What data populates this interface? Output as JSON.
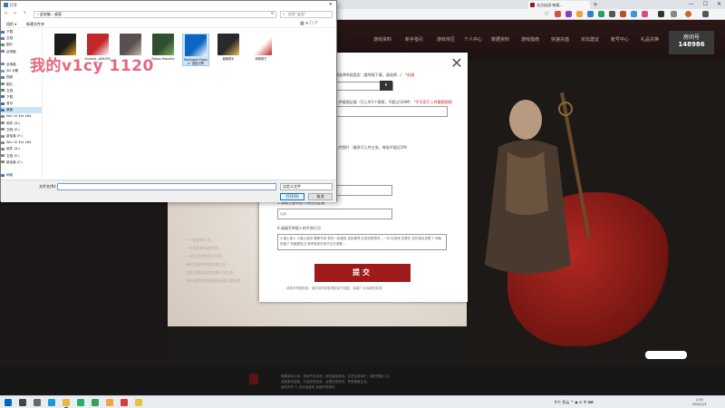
{
  "browser": {
    "tab_title": "太古仙语-修真…",
    "url_text": "",
    "new_tab": "+",
    "window_buttons": [
      "—",
      "☐",
      "✕"
    ],
    "star": "☆"
  },
  "site": {
    "nav_items": [
      "游戏资料",
      "新手指引",
      "游戏专区",
      "个人中心",
      "数据资料",
      "游戏指南",
      "快速充值",
      "论坛建议",
      "账号中心",
      "礼品兑换"
    ],
    "logo_text": "天下",
    "room_label": "房间号",
    "room_number": "148986",
    "left_lines": [
      "• 一些游戏行为…",
      "• 外挂作弊违规内容…",
      "• 扰乱游戏秩序行为等",
      "具体处理结果请查看公告",
      "对此问题及其他违规行为反馈",
      "举报请提供相关截图证据以便处理"
    ],
    "footer_lines": [
      "健康游戏公告：抵制不良游戏，拒绝盗版游戏。注意自我保护，谨防受骗上当。",
      "适度游戏益脑，沉迷游戏伤身。合理安排时间，享受健康生活。",
      "版权所有 © 游戏运营商 保留所有权利"
    ]
  },
  "form": {
    "close_glyph": "✕",
    "q1_label": "1.请选择举报类型（要举报下载，请选择…）",
    "q1_required": "*必填",
    "q1_select_arrow": "▾",
    "q2_label": "2.上传截图证据（可上传1个视频，不超过100M）",
    "q2_hint": "*不可用于上传截图视频",
    "q3_label": "3.上传图片（最多可上传五张，每张不超过5M）",
    "q4_label": "4.请填写被举报人的角色名",
    "q5_label": "5.请填写被举报人所在的区服",
    "q5_value": "仙缘",
    "q6_label": "6.请填写举报人的不良行为",
    "q6_value": "小道士偷人 小道士偷窃 屡教不改 冒充一起被捉 发帖辱骂 在游戏里冒充…一次 在游戏 还是在 这些事实说看了 你就知道了 有截图发过 被举报多的说不过去请看…",
    "submit": "提交",
    "footnote": "请填写举报信息，我们将尽快处理并给予回复，感谢广大玩家的支持！"
  },
  "dialog": {
    "title": "打开",
    "close_glyph": "✕",
    "nav_back": "←",
    "nav_forward": "→",
    "nav_up": "↑",
    "address_path": "› 此电脑 › 桌面",
    "refresh": "↻",
    "search_placeholder": "搜索\"桌面\"",
    "search_icon": "⌕",
    "cmd_organize": "组织 ▾",
    "cmd_newfolder": "新建文件夹",
    "view_icons": "▦ ▾  ☐  ?",
    "sidebar": [
      {
        "label": "下载",
        "color": "#3a78c3"
      },
      {
        "label": "文档",
        "color": "#6a7a8a"
      },
      {
        "label": "图片",
        "color": "#4a9a6a"
      },
      {
        "label": "此电脑",
        "color": "#6a8ab0"
      },
      {
        "label": "",
        "color": "#ffffff"
      },
      {
        "label": "此电脑",
        "color": "#6a8ab0"
      },
      {
        "label": "3D 对象",
        "color": "#7aa0c0"
      },
      {
        "label": "视频",
        "color": "#6a7a8a"
      },
      {
        "label": "图片",
        "color": "#4a9a6a"
      },
      {
        "label": "文档",
        "color": "#6a7a8a"
      },
      {
        "label": "下载",
        "color": "#3a78c3"
      },
      {
        "label": "音乐",
        "color": "#4a6aa0"
      },
      {
        "label": "桌面",
        "color": "#3a78c3",
        "selected": true
      },
      {
        "label": "Win 10 Ent x64",
        "color": "#888888"
      },
      {
        "label": "软件 (D:)",
        "color": "#888888"
      },
      {
        "label": "文档 (E:)",
        "color": "#888888"
      },
      {
        "label": "新加卷 (F:)",
        "color": "#888888"
      },
      {
        "label": "Win 10 Ent x64",
        "color": "#888888"
      },
      {
        "label": "软件 (D:)",
        "color": "#888888"
      },
      {
        "label": "文档 (E:)",
        "color": "#888888"
      },
      {
        "label": "新加卷 (F:)",
        "color": "#888888"
      },
      {
        "label": "",
        "color": "#ffffff"
      },
      {
        "label": "网络",
        "color": "#3a78c3"
      }
    ],
    "files": [
      {
        "name": "",
        "color": "#1c1c1c",
        "accent": "#e0a020"
      },
      {
        "name": "Android...ADK(PG) GL...",
        "color": "#c2282a",
        "accent": "#ffffff"
      },
      {
        "name": "",
        "color": "#5a5050",
        "accent": "#c8b8a8"
      },
      {
        "name": "Roblox Republic",
        "color": "#2f4f2f",
        "accent": "#7ab05a"
      },
      {
        "name": "Wallpaper Engine：壁纸引擎",
        "color": "#0a66c2",
        "accent": "#ffffff",
        "selected": true
      },
      {
        "name": "客服助手",
        "color": "#2a2a2a",
        "accent": "#e8c050"
      },
      {
        "name": "网络助力",
        "color": "#ffffff",
        "accent": "#c2282a"
      }
    ],
    "filename_label": "文件名(N):",
    "filename_value": "",
    "filter": "自定义文件",
    "open": "打开(O)",
    "cancel": "取消"
  },
  "watermark": "我的v1cy 1120",
  "taskbar": {
    "apps": [
      {
        "name": "start",
        "color": "#0067c0"
      },
      {
        "name": "search",
        "color": "#444444"
      },
      {
        "name": "task-view",
        "color": "#666666"
      },
      {
        "name": "edge",
        "color": "#1a9bd7"
      },
      {
        "name": "explorer",
        "color": "#e8b83a",
        "active": true
      },
      {
        "name": "wechat",
        "color": "#2aae67"
      },
      {
        "name": "app-green",
        "color": "#3aa055"
      },
      {
        "name": "app-orange",
        "color": "#f2a43a"
      },
      {
        "name": "app-red",
        "color": "#d83b3b"
      },
      {
        "name": "app-yellow",
        "color": "#e9c43a"
      }
    ],
    "tray": "6℃ 多云  ^  ◉  ⊡  中  ⌨",
    "time": "1:53",
    "date": "2021/1/1"
  }
}
